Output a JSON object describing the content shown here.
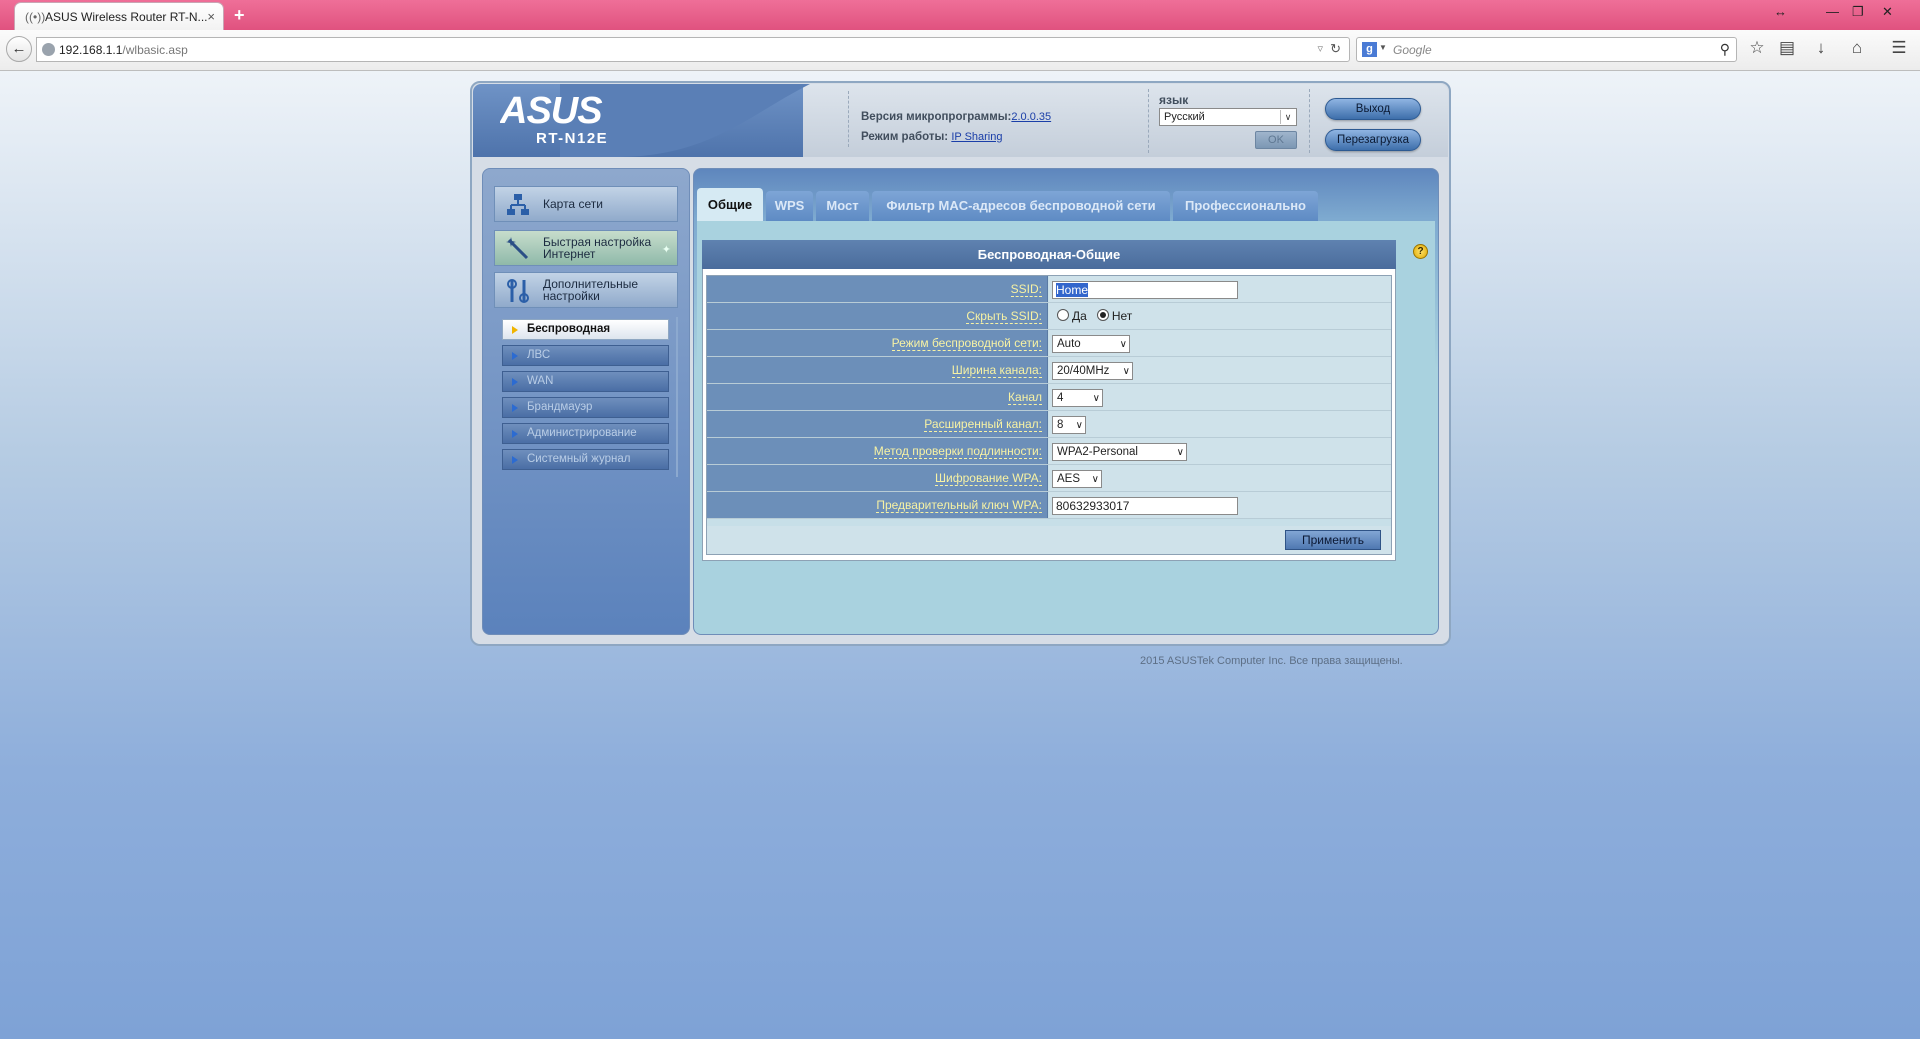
{
  "browser": {
    "tab_title": "ASUS Wireless Router RT-N...",
    "tab_close": "×",
    "new_tab": "+",
    "url_host": "192.168.1.1",
    "url_path": "/wlbasic.asp",
    "search_placeholder": "Google",
    "search_engine_letter": "g",
    "window_buttons": [
      "↔",
      "—",
      "❐",
      "✕"
    ],
    "toolbar_icons": [
      "star-icon",
      "reading-list-icon",
      "download-icon",
      "home-icon",
      "menu-icon"
    ]
  },
  "header": {
    "logo_text": "ASUS",
    "model": "RT-N12E",
    "firmware_label": "Версия микропрограммы:",
    "firmware_version": "2.0.0.35",
    "mode_label": "Режим работы:",
    "mode_value": "IP Sharing",
    "language_label": "язык",
    "language_value": "Русский",
    "ok_label": "OK",
    "logout_label": "Выход",
    "reboot_label": "Перезагрузка"
  },
  "sidebar": {
    "main_items": [
      {
        "label": "Карта сети",
        "icon": "network-map-icon"
      },
      {
        "label": "Быстрая настройка Интернет",
        "icon": "wand-icon"
      },
      {
        "label": "Дополнительные настройки",
        "icon": "tools-icon"
      }
    ],
    "sub_items": [
      {
        "label": "Беспроводная",
        "active": true
      },
      {
        "label": "ЛВС",
        "active": false
      },
      {
        "label": "WAN",
        "active": false
      },
      {
        "label": "Брандмауэр",
        "active": false
      },
      {
        "label": "Администрирование",
        "active": false
      },
      {
        "label": "Системный журнал",
        "active": false
      }
    ]
  },
  "tabs": [
    {
      "label": "Общие",
      "active": true
    },
    {
      "label": "WPS",
      "active": false
    },
    {
      "label": "Мост",
      "active": false
    },
    {
      "label": "Фильтр MAC-адресов беспроводной сети",
      "active": false
    },
    {
      "label": "Профессионально",
      "active": false
    }
  ],
  "form": {
    "title": "Беспроводная-Общие",
    "ssid_label": "SSID:",
    "ssid_value": "Home",
    "hide_ssid_label": "Скрыть SSID:",
    "hide_yes": "Да",
    "hide_no": "Нет",
    "hide_selected": "Нет",
    "mode_label": "Режим беспроводной сети:",
    "mode_value": "Auto",
    "width_label": "Ширина канала:",
    "width_value": "20/40MHz",
    "channel_label": "Канал",
    "channel_value": "4",
    "ext_channel_label": "Расширенный канал:",
    "ext_channel_value": "8",
    "auth_label": "Метод проверки подлинности:",
    "auth_value": "WPA2-Personal",
    "enc_label": "Шифрование WPA:",
    "enc_value": "AES",
    "key_label": "Предварительный ключ WPA:",
    "key_value": "80632933017",
    "apply_label": "Применить"
  },
  "footer": "2015 ASUSTek Computer Inc. Все права защищены."
}
